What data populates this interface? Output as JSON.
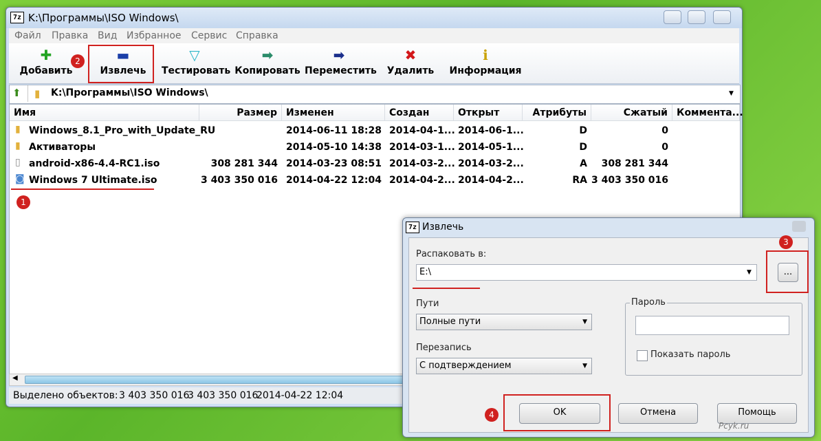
{
  "window": {
    "title": "K:\\Программы\\ISO Windows\\",
    "app_icon": "7z"
  },
  "menu": [
    "Файл",
    "Правка",
    "Вид",
    "Избранное",
    "Сервис",
    "Справка"
  ],
  "toolbar": {
    "add": "Добавить",
    "extract": "Извлечь",
    "test": "Тестировать",
    "copy": "Копировать",
    "move": "Переместить",
    "delete": "Удалить",
    "info": "Информация"
  },
  "address": {
    "path": "K:\\Программы\\ISO Windows\\"
  },
  "columns": [
    "Имя",
    "Размер",
    "Изменен",
    "Создан",
    "Открыт",
    "Атрибуты",
    "Сжатый",
    "Коммента..."
  ],
  "files": [
    {
      "icon": "folder-icon",
      "name": "Windows_8.1_Pro_with_Update_RU",
      "size": "",
      "modified": "2014-06-11 18:28",
      "created": "2014-04-1...",
      "opened": "2014-06-1...",
      "attr": "D",
      "packed": "0"
    },
    {
      "icon": "folder-icon",
      "name": "Активаторы",
      "size": "",
      "modified": "2014-05-10 14:38",
      "created": "2014-03-1...",
      "opened": "2014-05-1...",
      "attr": "D",
      "packed": "0"
    },
    {
      "icon": "file-icon",
      "name": "android-x86-4.4-RC1.iso",
      "size": "308 281 344",
      "modified": "2014-03-23 08:51",
      "created": "2014-03-2...",
      "opened": "2014-03-2...",
      "attr": "A",
      "packed": "308 281 344"
    },
    {
      "icon": "iso-icon",
      "name": "Windows 7 Ultimate.iso",
      "size": "3 403 350 016",
      "modified": "2014-04-22 12:04",
      "created": "2014-04-2...",
      "opened": "2014-04-2...",
      "attr": "RA",
      "packed": "3 403 350 016"
    }
  ],
  "status": {
    "selected_label": "Выделено объектов:",
    "v1": "3 403 350 016",
    "v2": "3 403 350 016",
    "v3": "2014-04-22 12:04"
  },
  "badges": [
    "1",
    "2",
    "3",
    "4"
  ],
  "dialog": {
    "title": "Извлечь",
    "extract_to_label": "Распаковать в:",
    "extract_to_value": "E:\\",
    "browse": "...",
    "paths_label": "Пути",
    "paths_value": "Полные пути",
    "overwrite_label": "Перезапись",
    "overwrite_value": "С подтверждением",
    "password_group": "Пароль",
    "password_value": "",
    "show_password": "Показать пароль",
    "ok": "OK",
    "cancel": "Отмена",
    "help": "Помощь"
  },
  "watermark": "Pcyk.ru",
  "colors": {
    "accent_red": "#d0211f",
    "titlebar": "#cfe0f4",
    "desktop": "#6cc232"
  }
}
